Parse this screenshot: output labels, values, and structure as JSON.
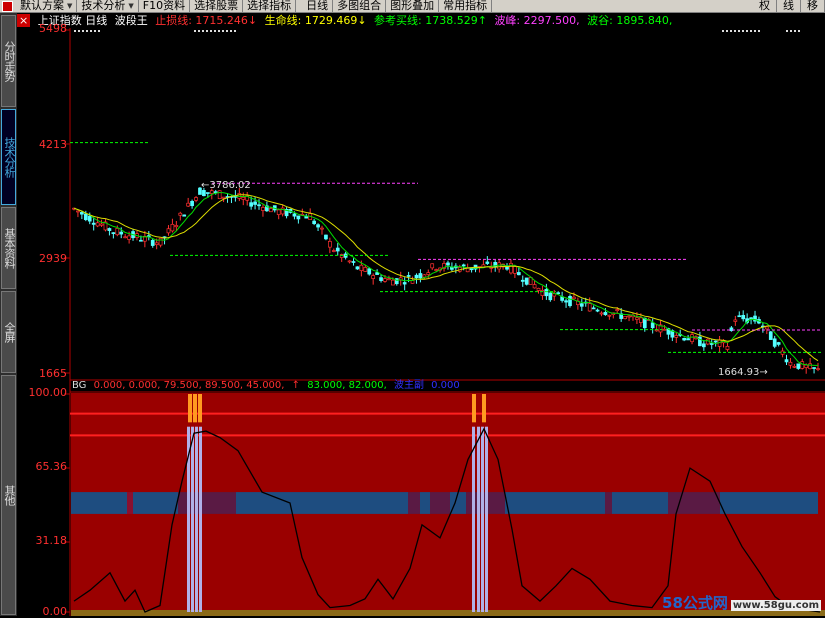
{
  "toolbar": {
    "items": [
      "默认方案",
      "技术分析",
      "F10资料",
      "选择股票",
      "选择指标",
      "日线",
      "多图组合",
      "图形叠加",
      "常用指标"
    ],
    "right_items": [
      "权",
      "线",
      "移"
    ]
  },
  "sidebar": {
    "tabs": [
      "分时走势",
      "技术分析",
      "基本资料",
      "全屏",
      "其他"
    ]
  },
  "infobar": {
    "title": "上证指数 日线",
    "indicator": "波段王",
    "stop_loss": "止损线: 1715.246↓",
    "life_line": "生命线: 1729.469↓",
    "ref_buy": "参考买线: 1738.529↑",
    "peak": "波峰: 2297.500,",
    "trough": "波谷: 1895.840,"
  },
  "main_axis": {
    "labels": [
      "5498",
      "4213",
      "2939",
      "1665"
    ]
  },
  "annotations": {
    "high": "←3786.02",
    "low": "1664.93→"
  },
  "indicator_bar": {
    "name": "BG",
    "values1": "0.000, 0.000, 79.500, 89.500, 45.000,",
    "arrow": "↑",
    "values2": "83.000, 82.000,",
    "label3": "波主副",
    "value3": "0.000"
  },
  "lower_axis": {
    "labels": [
      "100.00",
      "65.36",
      "31.18",
      "0.00"
    ]
  },
  "watermark": {
    "brand": "58公式网",
    "url": "www.58gu.com"
  },
  "colors": {
    "up": "#ff3030",
    "down": "#54ffff",
    "stop_loss": "#ff3030",
    "life_line": "#ffff00",
    "ref_buy": "#00ff00",
    "peak": "#ff40ff",
    "trough": "#00ff00"
  },
  "chart_data": {
    "type": "candlestick",
    "price_axis_ticks": [
      5498,
      4213,
      2939,
      1665
    ],
    "high_annotation": 3786.02,
    "low_annotation": 1664.93,
    "indicator_axis_ticks": [
      100.0,
      65.36,
      31.18,
      0.0
    ],
    "indicator_values_header": [
      0.0,
      0.0,
      79.5,
      89.5,
      45.0,
      83.0,
      82.0,
      0.0
    ]
  }
}
